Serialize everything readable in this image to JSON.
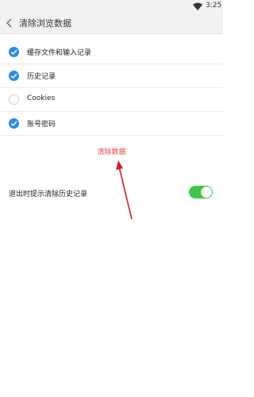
{
  "status_bar": {
    "time": "3:25",
    "wifi_icon": "wifi-icon"
  },
  "header": {
    "title": "清除浏览数据",
    "back_icon": "chevron-left-icon"
  },
  "options": [
    {
      "label": "缓存文件和输入记录",
      "checked": true
    },
    {
      "label": "历史记录",
      "checked": true
    },
    {
      "label": "Cookies",
      "checked": false
    },
    {
      "label": "账号密码",
      "checked": true
    }
  ],
  "clear_button": {
    "label": "清除数据",
    "color": "#e84a3c"
  },
  "toggle_setting": {
    "label": "退出时提示清除历史记录",
    "on": true,
    "color": "#3fc54a"
  },
  "accent_color": "#2a8be4",
  "annotation_arrow_color": "#d42020"
}
